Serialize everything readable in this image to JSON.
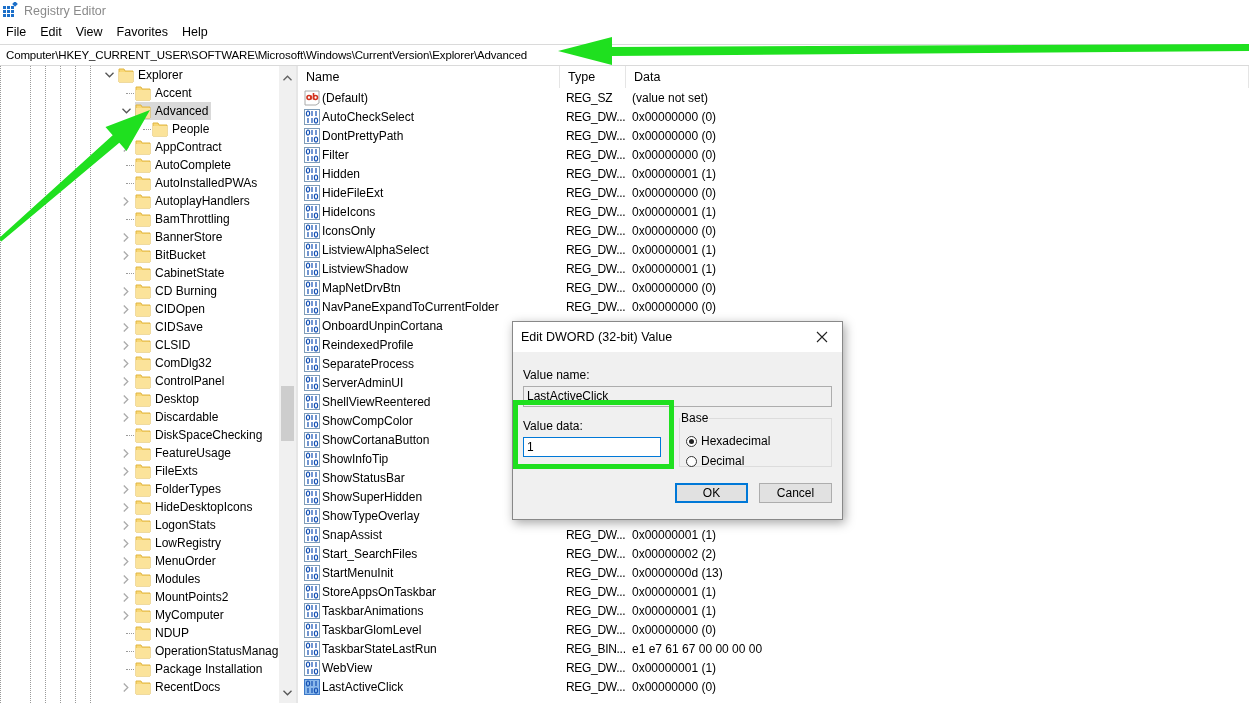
{
  "window": {
    "title": "Registry Editor"
  },
  "menu": [
    "File",
    "Edit",
    "View",
    "Favorites",
    "Help"
  ],
  "address": "Computer\\HKEY_CURRENT_USER\\SOFTWARE\\Microsoft\\Windows\\CurrentVersion\\Explorer\\Advanced",
  "tree": {
    "items": [
      {
        "label": "Explorer",
        "kind": "branch",
        "expanded": true,
        "selected": false,
        "children": [
          {
            "label": "Accent",
            "kind": "leaf",
            "selected": false
          },
          {
            "label": "Advanced",
            "kind": "branch",
            "expanded": true,
            "selected": true,
            "children": [
              {
                "label": "People",
                "kind": "leaf",
                "selected": false
              }
            ]
          },
          {
            "label": "AppContract",
            "kind": "branch",
            "expanded": false,
            "selected": false
          },
          {
            "label": "AutoComplete",
            "kind": "leaf",
            "selected": false
          },
          {
            "label": "AutoInstalledPWAs",
            "kind": "leaf",
            "selected": false
          },
          {
            "label": "AutoplayHandlers",
            "kind": "branch",
            "expanded": false,
            "selected": false
          },
          {
            "label": "BamThrottling",
            "kind": "leaf",
            "selected": false
          },
          {
            "label": "BannerStore",
            "kind": "branch",
            "expanded": false,
            "selected": false
          },
          {
            "label": "BitBucket",
            "kind": "branch",
            "expanded": false,
            "selected": false
          },
          {
            "label": "CabinetState",
            "kind": "leaf",
            "selected": false
          },
          {
            "label": "CD Burning",
            "kind": "branch",
            "expanded": false,
            "selected": false
          },
          {
            "label": "CIDOpen",
            "kind": "branch",
            "expanded": false,
            "selected": false
          },
          {
            "label": "CIDSave",
            "kind": "branch",
            "expanded": false,
            "selected": false
          },
          {
            "label": "CLSID",
            "kind": "branch",
            "expanded": false,
            "selected": false
          },
          {
            "label": "ComDlg32",
            "kind": "branch",
            "expanded": false,
            "selected": false
          },
          {
            "label": "ControlPanel",
            "kind": "branch",
            "expanded": false,
            "selected": false
          },
          {
            "label": "Desktop",
            "kind": "branch",
            "expanded": false,
            "selected": false
          },
          {
            "label": "Discardable",
            "kind": "branch",
            "expanded": false,
            "selected": false
          },
          {
            "label": "DiskSpaceChecking",
            "kind": "leaf",
            "selected": false
          },
          {
            "label": "FeatureUsage",
            "kind": "branch",
            "expanded": false,
            "selected": false
          },
          {
            "label": "FileExts",
            "kind": "branch",
            "expanded": false,
            "selected": false
          },
          {
            "label": "FolderTypes",
            "kind": "branch",
            "expanded": false,
            "selected": false
          },
          {
            "label": "HideDesktopIcons",
            "kind": "branch",
            "expanded": false,
            "selected": false
          },
          {
            "label": "LogonStats",
            "kind": "branch",
            "expanded": false,
            "selected": false
          },
          {
            "label": "LowRegistry",
            "kind": "branch",
            "expanded": false,
            "selected": false
          },
          {
            "label": "MenuOrder",
            "kind": "branch",
            "expanded": false,
            "selected": false
          },
          {
            "label": "Modules",
            "kind": "branch",
            "expanded": false,
            "selected": false
          },
          {
            "label": "MountPoints2",
            "kind": "branch",
            "expanded": false,
            "selected": false
          },
          {
            "label": "MyComputer",
            "kind": "branch",
            "expanded": false,
            "selected": false
          },
          {
            "label": "NDUP",
            "kind": "leaf",
            "selected": false
          },
          {
            "label": "OperationStatusManag",
            "kind": "leaf",
            "selected": false
          },
          {
            "label": "Package Installation",
            "kind": "leaf",
            "selected": false
          },
          {
            "label": "RecentDocs",
            "kind": "branch",
            "expanded": false,
            "selected": false
          }
        ]
      }
    ]
  },
  "list": {
    "columns": [
      "Name",
      "Type",
      "Data"
    ],
    "rows": [
      {
        "kind": "string",
        "name": "(Default)",
        "type": "REG_SZ",
        "data": "(value not set)",
        "selected": false
      },
      {
        "kind": "number",
        "name": "AutoCheckSelect",
        "type": "REG_DW...",
        "data": "0x00000000 (0)",
        "selected": false
      },
      {
        "kind": "number",
        "name": "DontPrettyPath",
        "type": "REG_DW...",
        "data": "0x00000000 (0)",
        "selected": false
      },
      {
        "kind": "number",
        "name": "Filter",
        "type": "REG_DW...",
        "data": "0x00000000 (0)",
        "selected": false
      },
      {
        "kind": "number",
        "name": "Hidden",
        "type": "REG_DW...",
        "data": "0x00000001 (1)",
        "selected": false
      },
      {
        "kind": "number",
        "name": "HideFileExt",
        "type": "REG_DW...",
        "data": "0x00000000 (0)",
        "selected": false
      },
      {
        "kind": "number",
        "name": "HideIcons",
        "type": "REG_DW...",
        "data": "0x00000001 (1)",
        "selected": false
      },
      {
        "kind": "number",
        "name": "IconsOnly",
        "type": "REG_DW...",
        "data": "0x00000000 (0)",
        "selected": false
      },
      {
        "kind": "number",
        "name": "ListviewAlphaSelect",
        "type": "REG_DW...",
        "data": "0x00000001 (1)",
        "selected": false
      },
      {
        "kind": "number",
        "name": "ListviewShadow",
        "type": "REG_DW...",
        "data": "0x00000001 (1)",
        "selected": false
      },
      {
        "kind": "number",
        "name": "MapNetDrvBtn",
        "type": "REG_DW...",
        "data": "0x00000000 (0)",
        "selected": false
      },
      {
        "kind": "number",
        "name": "NavPaneExpandToCurrentFolder",
        "type": "REG_DW...",
        "data": "0x00000000 (0)",
        "selected": false
      },
      {
        "kind": "number",
        "name": "OnboardUnpinCortana",
        "selected": false
      },
      {
        "kind": "number",
        "name": "ReindexedProfile",
        "selected": false
      },
      {
        "kind": "number",
        "name": "SeparateProcess",
        "selected": false
      },
      {
        "kind": "number",
        "name": "ServerAdminUI",
        "selected": false
      },
      {
        "kind": "number",
        "name": "ShellViewReentered",
        "selected": false
      },
      {
        "kind": "number",
        "name": "ShowCompColor",
        "selected": false
      },
      {
        "kind": "number",
        "name": "ShowCortanaButton",
        "selected": false
      },
      {
        "kind": "number",
        "name": "ShowInfoTip",
        "selected": false
      },
      {
        "kind": "number",
        "name": "ShowStatusBar",
        "selected": false
      },
      {
        "kind": "number",
        "name": "ShowSuperHidden",
        "selected": false
      },
      {
        "kind": "number",
        "name": "ShowTypeOverlay",
        "selected": false
      },
      {
        "kind": "number",
        "name": "SnapAssist",
        "type": "REG_DW...",
        "data": "0x00000001 (1)",
        "selected": false
      },
      {
        "kind": "number",
        "name": "Start_SearchFiles",
        "type": "REG_DW...",
        "data": "0x00000002 (2)",
        "selected": false
      },
      {
        "kind": "number",
        "name": "StartMenuInit",
        "type": "REG_DW...",
        "data": "0x0000000d (13)",
        "selected": false
      },
      {
        "kind": "number",
        "name": "StoreAppsOnTaskbar",
        "type": "REG_DW...",
        "data": "0x00000001 (1)",
        "selected": false
      },
      {
        "kind": "number",
        "name": "TaskbarAnimations",
        "type": "REG_DW...",
        "data": "0x00000001 (1)",
        "selected": false
      },
      {
        "kind": "number",
        "name": "TaskbarGlomLevel",
        "type": "REG_DW...",
        "data": "0x00000000 (0)",
        "selected": false
      },
      {
        "kind": "number",
        "name": "TaskbarStateLastRun",
        "type": "REG_BIN...",
        "data": "e1 e7 61 67 00 00 00 00",
        "selected": false
      },
      {
        "kind": "number",
        "name": "WebView",
        "type": "REG_DW...",
        "data": "0x00000001 (1)",
        "selected": false
      },
      {
        "kind": "number",
        "name": "LastActiveClick",
        "type": "REG_DW...",
        "data": "0x00000000 (0)",
        "selected": true
      }
    ]
  },
  "dialog": {
    "title": "Edit DWORD (32-bit) Value",
    "value_name_label": "Value name:",
    "value_name": "LastActiveClick",
    "value_data_label": "Value data:",
    "value_data": "1",
    "base_label": "Base",
    "bases": [
      {
        "label": "Hexadecimal",
        "selected": true
      },
      {
        "label": "Decimal",
        "selected": false
      }
    ],
    "buttons": [
      {
        "label": "OK",
        "default": true
      },
      {
        "label": "Cancel",
        "default": false
      }
    ]
  }
}
